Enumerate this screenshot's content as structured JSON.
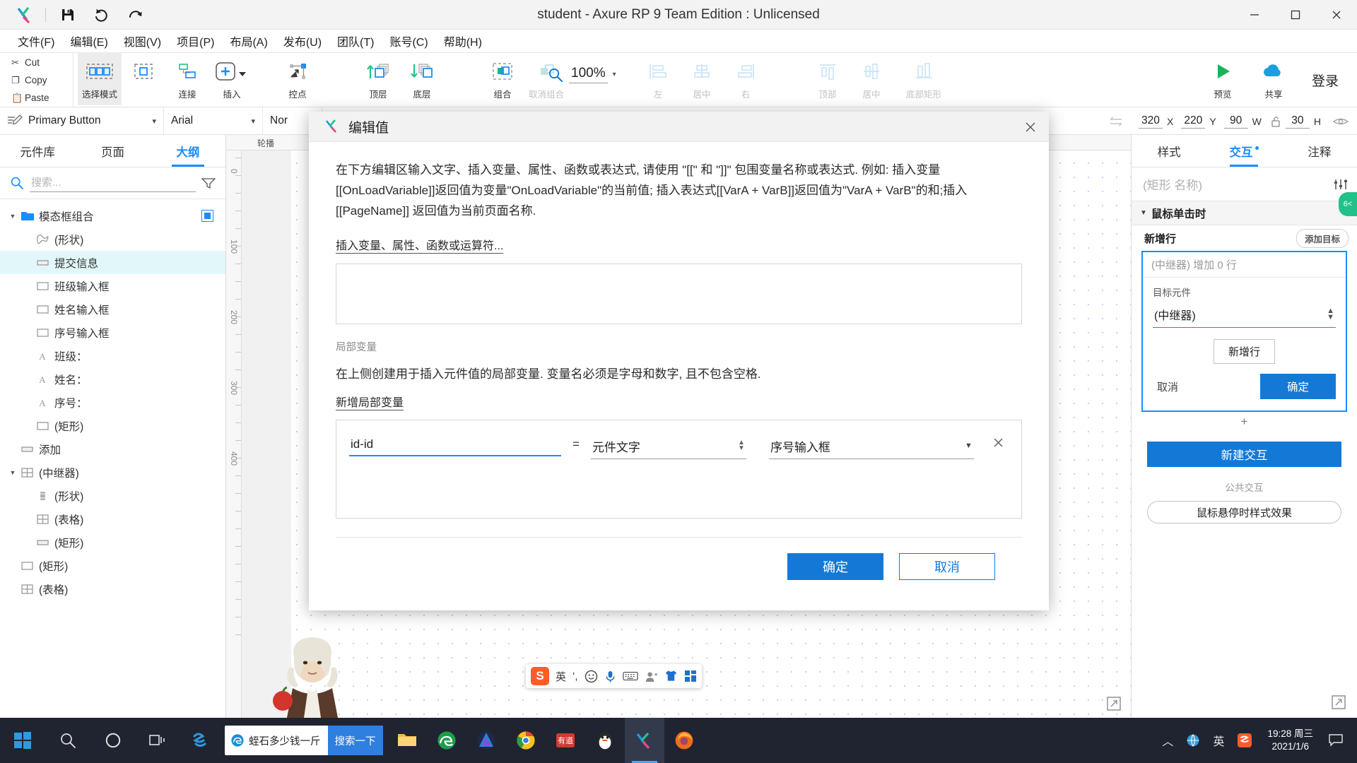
{
  "titlebar": {
    "title": "student - Axure RP 9 Team Edition : Unlicensed",
    "save_icon": "save-icon",
    "undo_icon": "undo-icon",
    "redo_icon": "redo-icon",
    "minimize": "minimize-icon",
    "maximize": "maximize-icon",
    "close": "close-icon"
  },
  "menubar": {
    "items": [
      {
        "label": "文件(F)"
      },
      {
        "label": "编辑(E)"
      },
      {
        "label": "视图(V)"
      },
      {
        "label": "项目(P)"
      },
      {
        "label": "布局(A)"
      },
      {
        "label": "发布(U)"
      },
      {
        "label": "团队(T)"
      },
      {
        "label": "账号(C)"
      },
      {
        "label": "帮助(H)"
      }
    ]
  },
  "ribbon": {
    "clipboard": [
      {
        "label": "Cut",
        "icon": "scissors-icon"
      },
      {
        "label": "Copy",
        "icon": "copy-icon"
      },
      {
        "label": "Paste",
        "icon": "clipboard-icon"
      }
    ],
    "buttons": [
      {
        "label": "选择模式",
        "icon": "select-mode-icon",
        "dim": false
      },
      {
        "label": "连接",
        "icon": "connect-icon",
        "dim": false
      },
      {
        "label": "插入",
        "icon": "insert-plus-icon",
        "dim": false
      },
      {
        "label": "控点",
        "icon": "handle-point-icon",
        "dim": false
      },
      {
        "label": "顶层",
        "icon": "bring-front-icon",
        "dim": false
      },
      {
        "label": "底层",
        "icon": "send-back-icon",
        "dim": false
      },
      {
        "label": "组合",
        "icon": "group-icon",
        "dim": false
      },
      {
        "label": "取消组合",
        "icon": "ungroup-icon",
        "dim": true
      },
      {
        "label": "左",
        "icon": "align-left-icon",
        "dim": true
      },
      {
        "label": "居中",
        "icon": "align-center-icon",
        "dim": true
      },
      {
        "label": "右",
        "icon": "align-right-icon",
        "dim": true
      },
      {
        "label": "顶部",
        "icon": "align-top-icon",
        "dim": true
      },
      {
        "label": "居中",
        "icon": "align-middle-icon",
        "dim": true
      },
      {
        "label": "底部矩形",
        "icon": "align-bottom-icon",
        "dim": true
      }
    ],
    "zoom": {
      "value": "100%",
      "icon": "zoom-search-icon",
      "caret": "▾"
    },
    "overflow": "»",
    "right_buttons": [
      {
        "label": "预览",
        "icon": "preview-play-icon"
      },
      {
        "label": "共享",
        "icon": "share-cloud-icon"
      }
    ],
    "login_label": "登录"
  },
  "propstrip": {
    "style_name": "Primary Button",
    "style_icon": "style-edit-icon",
    "font_name": "Arial",
    "weight": "Nor",
    "caret": "▾",
    "geometry": {
      "x_value": "320",
      "x_label": "X",
      "y_value": "220",
      "y_label": "Y",
      "w_value": "90",
      "w_label": "W",
      "h_value": "30",
      "h_label": "H",
      "lock_icon": "lock-open-icon",
      "eye_icon": "eye-icon",
      "swap_icon": "swap-arrows-icon"
    }
  },
  "left_panel": {
    "tabs": [
      {
        "label": "元件库",
        "active": false
      },
      {
        "label": "页面",
        "active": false
      },
      {
        "label": "大纲",
        "active": true
      }
    ],
    "search": {
      "placeholder": "搜索...",
      "value": "",
      "icon": "search-icon",
      "filter_icon": "filter-icon"
    },
    "tree": [
      {
        "label": "模态框组合",
        "icon": "folder-icon",
        "indent": 0,
        "arrow": "▼",
        "selected": false,
        "badge": true
      },
      {
        "label": "(形状)",
        "icon": "shape-x-icon",
        "indent": 1,
        "arrow": "",
        "selected": false,
        "badge": false
      },
      {
        "label": "提交信息",
        "icon": "button-icon",
        "indent": 1,
        "arrow": "",
        "selected": true,
        "badge": false
      },
      {
        "label": "班级输入框",
        "icon": "rect-icon",
        "indent": 1,
        "arrow": "",
        "selected": false,
        "badge": false
      },
      {
        "label": "姓名输入框",
        "icon": "rect-icon",
        "indent": 1,
        "arrow": "",
        "selected": false,
        "badge": false
      },
      {
        "label": "序号输入框",
        "icon": "rect-icon",
        "indent": 1,
        "arrow": "",
        "selected": false,
        "badge": false
      },
      {
        "label": "班级：",
        "icon": "text-a-icon",
        "indent": 1,
        "arrow": "",
        "selected": false,
        "badge": false
      },
      {
        "label": "姓名：",
        "icon": "text-a-icon",
        "indent": 1,
        "arrow": "",
        "selected": false,
        "badge": false
      },
      {
        "label": "序号：",
        "icon": "text-a-icon",
        "indent": 1,
        "arrow": "",
        "selected": false,
        "badge": false
      },
      {
        "label": "(矩形)",
        "icon": "rect-icon",
        "indent": 1,
        "arrow": "",
        "selected": false,
        "badge": false
      },
      {
        "label": "添加",
        "icon": "button-icon",
        "indent": 0,
        "arrow": "",
        "selected": false,
        "badge": false
      },
      {
        "label": "(中继器)",
        "icon": "repeater-icon",
        "indent": 0,
        "arrow": "▼",
        "selected": false,
        "badge": false
      },
      {
        "label": "(形状)",
        "icon": "trash-icon",
        "indent": 1,
        "arrow": "",
        "selected": false,
        "badge": false
      },
      {
        "label": "(表格)",
        "icon": "repeater-icon",
        "indent": 1,
        "arrow": "",
        "selected": false,
        "badge": false
      },
      {
        "label": "(矩形)",
        "icon": "button-icon",
        "indent": 1,
        "arrow": "",
        "selected": false,
        "badge": false
      },
      {
        "label": "(矩形)",
        "icon": "rect-icon",
        "indent": 0,
        "arrow": "",
        "selected": false,
        "badge": false
      },
      {
        "label": "(表格)",
        "icon": "repeater-icon",
        "indent": 0,
        "arrow": "",
        "selected": false,
        "badge": false
      }
    ]
  },
  "canvas": {
    "page_tab": "轮播",
    "ruler_labels": [
      "0",
      "100",
      "200",
      "300",
      "400"
    ],
    "float_icon": "expand-icon"
  },
  "ime": {
    "logo": "S",
    "lang": "英",
    "items": [
      "quote-icon",
      "emoji-icon",
      "mic-icon",
      "keyboard-icon",
      "user-icon",
      "shirt-icon",
      "apps-icon"
    ]
  },
  "right_panel": {
    "tabs": [
      {
        "label": "样式",
        "active": false
      },
      {
        "label": "交互",
        "active": true
      },
      {
        "label": "注释",
        "active": false
      }
    ],
    "name_placeholder": "(矩形 名称)",
    "settings_icon": "sliders-icon",
    "section": {
      "arrow": "▼",
      "title": "鼠标单击时"
    },
    "action": {
      "label": "新增行",
      "add_target_btn": "添加目标"
    },
    "config": {
      "header": "(中继器) 增加 0 行",
      "target_label": "目标元件",
      "target_value": "(中继器)",
      "caret": "⌃⌄",
      "add_row_button": "新增行",
      "cancel": "取消",
      "ok": "确定"
    },
    "plus": "+",
    "new_interaction": "新建交互",
    "public_title": "公共交互",
    "hover_style": "鼠标悬停时样式效果",
    "expand_icon": "expand-icon"
  },
  "modal": {
    "title": "编辑值",
    "logo": "axure-logo-icon",
    "close_icon": "close-icon",
    "description": "在下方编辑区输入文字、插入变量、属性、函数或表达式, 请使用 \"[[\" 和 \"]]\" 包围变量名称或表达式. 例如: 插入变量[[OnLoadVariable]]返回值为变量\"OnLoadVariable\"的当前值; 插入表达式[[VarA + VarB]]返回值为\"VarA + VarB\"的和;插入 [[PageName]] 返回值为当前页面名称.",
    "insert_link": "插入变量、属性、函数或运算符...",
    "editor_value": "",
    "local_var_label": "局部变量",
    "local_var_hint": "在上侧创建用于插入元件值的局部变量. 变量名必须是字母和数字, 且不包含空格.",
    "add_local_var_link": "新增局部变量",
    "variable_row": {
      "name": "id-id",
      "equals": "=",
      "prop_value": "元件文字",
      "prop_caret": "⌃⌄",
      "target_value": "序号输入框",
      "target_caret": "▼",
      "remove_icon": "close-icon"
    },
    "ok": "确定",
    "cancel": "取消"
  },
  "taskbar": {
    "start_icon": "windows-start-icon",
    "search_icon": "search-icon",
    "cortana_icon": "cortana-circle-icon",
    "taskview_icon": "task-view-icon",
    "search_box": {
      "query": "蛭石多少钱一斤",
      "button": "搜索一下",
      "icon": "edge-e-icon"
    },
    "apps": [
      {
        "name": "sogou-icon",
        "active": false
      },
      {
        "name": "file-explorer-icon",
        "active": false
      },
      {
        "name": "edge-icon",
        "active": false
      },
      {
        "name": "firefox-dev-icon",
        "active": false
      },
      {
        "name": "chrome-icon",
        "active": false
      },
      {
        "name": "youdao-icon",
        "active": false
      },
      {
        "name": "qq-penguin-icon",
        "active": false
      },
      {
        "name": "axure-icon",
        "active": true
      },
      {
        "name": "firefox-icon",
        "active": false
      }
    ],
    "tray": {
      "up_caret": "︿",
      "net_icon": "globe-icon",
      "ime_label": "英",
      "sogou_icon": "sogou-s-icon",
      "time": "19:28 周三",
      "date": "2021/1/6",
      "notify_icon": "notification-icon"
    }
  }
}
